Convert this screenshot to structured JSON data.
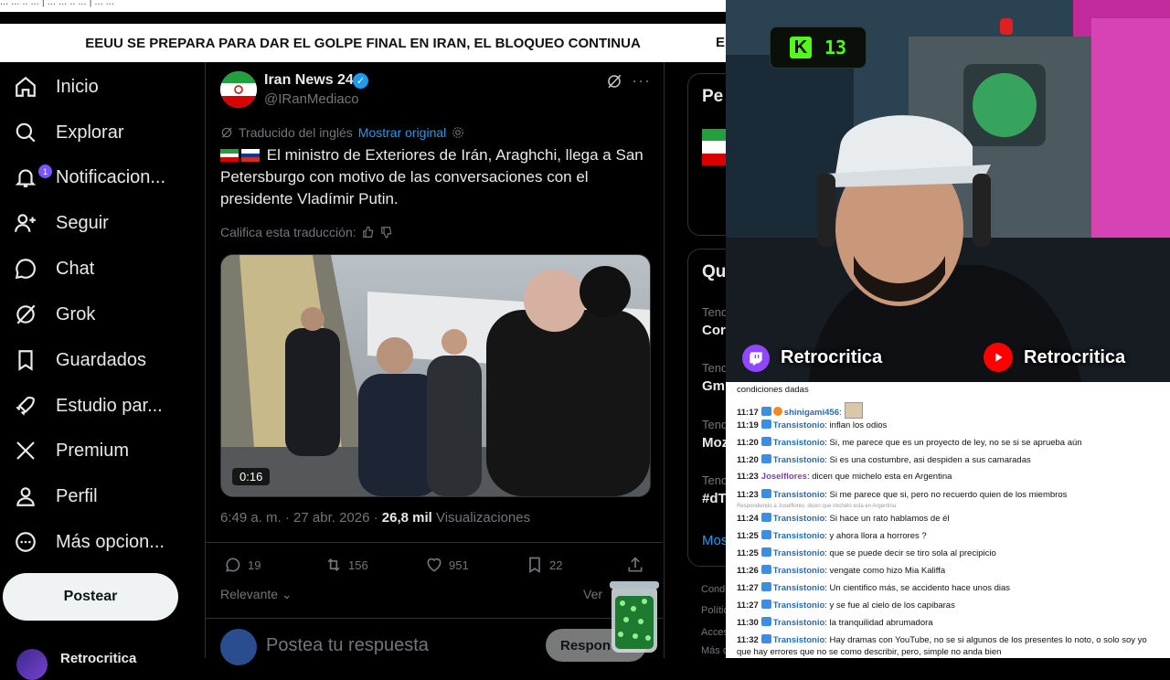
{
  "top_strip": {
    "text": "... ... .. ... | ... ... .. ... | ... ..."
  },
  "banner": {
    "text": "EEUU SE PREPARA PARA DAR EL GOLPE FINAL EN IRAN, EL BLOQUEO CONTINUA",
    "overflow_text": "EE"
  },
  "sidebar": {
    "items": [
      {
        "label": "Inicio",
        "icon": "home-icon"
      },
      {
        "label": "Explorar",
        "icon": "search-icon"
      },
      {
        "label": "Notificacion...",
        "icon": "bell-icon",
        "badge": "1"
      },
      {
        "label": "Seguir",
        "icon": "follow-icon"
      },
      {
        "label": "Chat",
        "icon": "chat-icon"
      },
      {
        "label": "Grok",
        "icon": "grok-icon"
      },
      {
        "label": "Guardados",
        "icon": "bookmark-icon"
      },
      {
        "label": "Estudio par...",
        "icon": "rocket-icon"
      },
      {
        "label": "Premium",
        "icon": "x-logo-icon"
      },
      {
        "label": "Perfil",
        "icon": "person-icon"
      },
      {
        "label": "Más opcion...",
        "icon": "more-circle-icon"
      }
    ],
    "post_button": "Postear",
    "profile_name": "Retrocritica"
  },
  "post": {
    "author": "Iran News 24",
    "handle": "@IRanMediaco",
    "translated_label": "Traducido del inglés",
    "show_original": "Mostrar original",
    "text": "El ministro de Exteriores de Irán, Araghchi, llega a San Petersburgo con motivo de las conversaciones con el presidente Vladímir Putin.",
    "rate_translation": "Califica esta traducción:",
    "video_duration": "0:16",
    "time": "6:49 a. m. · 27 abr. 2026 · ",
    "views_count": "26,8 mil",
    "views_label": " Visualizaciones",
    "replies": "19",
    "reposts": "156",
    "likes": "951",
    "bookmarks": "22",
    "sort_label": "Relevante",
    "see_more": "Ver",
    "reply_placeholder": "Postea tu respuesta",
    "reply_button": "Respon"
  },
  "right_column": {
    "card1_title": "Pe",
    "card2_title": "Qu",
    "trends": [
      {
        "label": "Tend",
        "value": "Cor"
      },
      {
        "label": "Tend",
        "value": "Gm"
      },
      {
        "label": "Tend",
        "value": "Moz"
      },
      {
        "label": "Tend",
        "value": "#dT"
      }
    ],
    "show_more": "Mos",
    "footer": [
      "Condi",
      "Polític",
      "Acces",
      "Más o"
    ]
  },
  "stream": {
    "kick_count": "13",
    "twitch_name": "Retrocritica",
    "youtube_name": "Retrocritica"
  },
  "chat": {
    "top_line": "condiciones dadas",
    "messages": [
      {
        "time": "11:17",
        "user": "shinigami456",
        "text": ""
      },
      {
        "time": "11:19",
        "user": "Transistonio",
        "text": ": inflan los odios"
      },
      {
        "time": "11:20",
        "user": "Transistonio",
        "text": ": Si, me parece que es un proyecto de ley, no se si se aprueba aún"
      },
      {
        "time": "11:20",
        "user": "Transistonio",
        "text": ": Si es una costumbre, asi despiden a sus camaradas"
      },
      {
        "time": "11:23",
        "user": "Joselflores",
        "text": ": dicen que michelo esta en Argentina"
      },
      {
        "time": "11:23",
        "user": "Transistonio",
        "text": ": Si me parece que si, pero no recuerdo quien de los miembros"
      },
      {
        "time": "11:24",
        "user": "Transistonio",
        "text": ": Si hace un rato hablamos de él"
      },
      {
        "time": "11:25",
        "user": "Transistonio",
        "text": ": y ahora llora a horrores ?"
      },
      {
        "time": "11:25",
        "user": "Transistonio",
        "text": ": que se puede decir se tiro sola al precipicio"
      },
      {
        "time": "11:26",
        "user": "Transistonio",
        "text": ": vengate como hizo Mia Kaliffa"
      },
      {
        "time": "11:27",
        "user": "Transistonio",
        "text": ": Un cientifico más, se accidento hace unos dias"
      },
      {
        "time": "11:27",
        "user": "Transistonio",
        "text": ": y se fue al cielo de los capibaras"
      },
      {
        "time": "11:30",
        "user": "Transistonio",
        "text": ": la tranquilidad abrumadora"
      },
      {
        "time": "11:32",
        "user": "Transistonio",
        "text": ": Hay dramas con YouTube, no se si algunos de los presentes lo noto, o solo soy yo"
      }
    ],
    "replying_note": "Respondiendo a Joselflores: dicen que michelo esta en Argentina",
    "last_line": "que hay errores que no se como describir, pero, simple no anda bien"
  }
}
